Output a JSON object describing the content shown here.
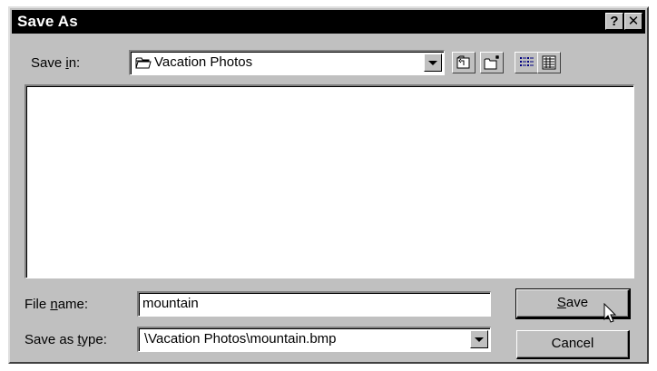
{
  "window": {
    "title": "Save As",
    "help_glyph": "?",
    "close_glyph": "✕"
  },
  "save_in": {
    "label_pre": "Save ",
    "label_accel": "i",
    "label_post": "n:",
    "value": "Vacation Photos",
    "icon": "folder-icon"
  },
  "toolbar": {
    "buttons": [
      "up-one-level-icon",
      "create-new-folder-icon",
      "list-view-icon",
      "details-view-icon"
    ]
  },
  "file_name": {
    "label_pre": "File ",
    "label_accel": "n",
    "label_post": "ame:",
    "value": "mountain"
  },
  "save_as_type": {
    "label_pre": "Save as ",
    "label_accel": "t",
    "label_post": "ype:",
    "value": "\\Vacation Photos\\mountain.bmp"
  },
  "buttons": {
    "save_accel": "S",
    "save_rest": "ave",
    "cancel": "Cancel"
  }
}
